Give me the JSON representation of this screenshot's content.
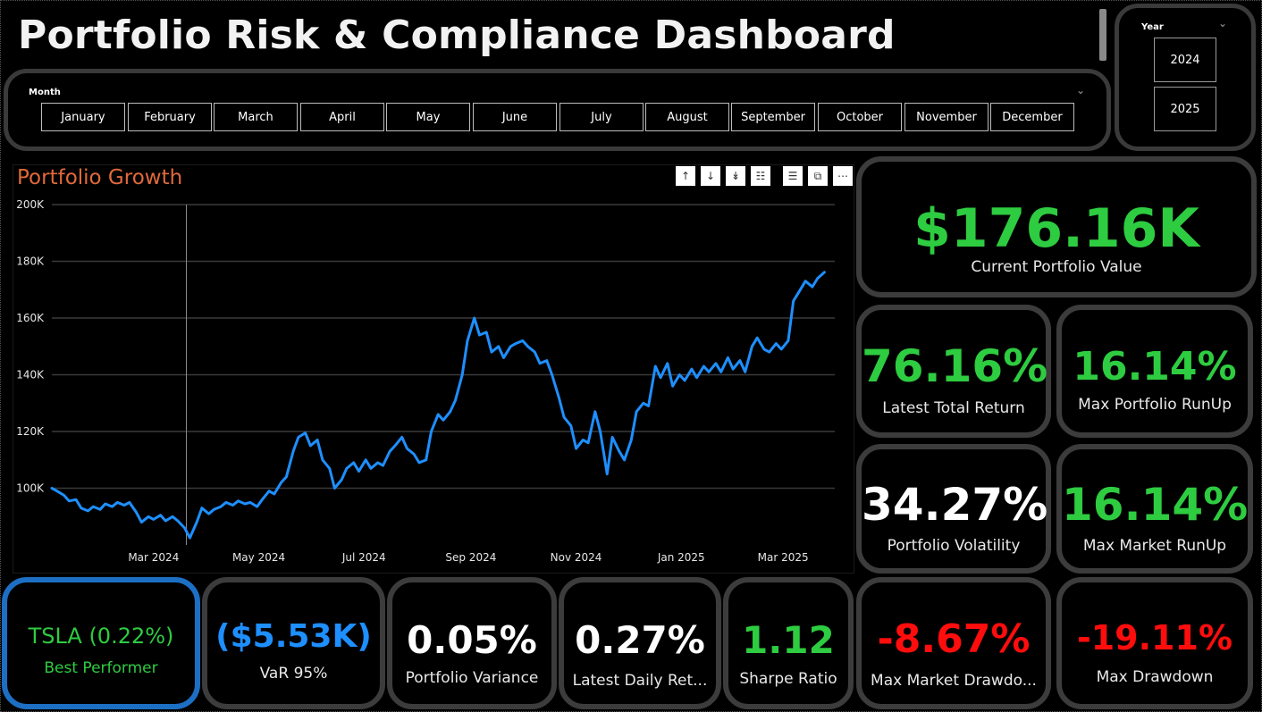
{
  "title": "Portfolio Risk & Compliance Dashboard",
  "month_slicer": {
    "label": "Month",
    "months": [
      "January",
      "February",
      "March",
      "April",
      "May",
      "June",
      "July",
      "August",
      "September",
      "October",
      "November",
      "December"
    ]
  },
  "year_slicer": {
    "label": "Year",
    "years": [
      "2024",
      "2025"
    ]
  },
  "chart_toolbar_icons": [
    "arrow-up-icon",
    "arrow-down-icon",
    "double-arrow-down-icon",
    "hierarchy-icon",
    "filter-icon",
    "focus-mode-icon",
    "more-options-icon"
  ],
  "colors": {
    "positive": "#2ecc40",
    "negative": "#ff0d0d",
    "blue": "#1e8fff",
    "chart_title": "#e0693a",
    "card_border": "#3c3c3c",
    "best_border": "#1d6fc4"
  },
  "kpis": {
    "current_value": {
      "value": "$176.16K",
      "label": "Current Portfolio Value"
    },
    "total_return": {
      "value": "76.16%",
      "label": "Latest Total Return"
    },
    "max_runup": {
      "value": "16.14%",
      "label": "Max Portfolio RunUp"
    },
    "volatility": {
      "value": "34.27%",
      "label": "Portfolio Volatility"
    },
    "market_runup": {
      "value": "16.14%",
      "label": "Max Market RunUp"
    },
    "best_performer": {
      "value": "TSLA (0.22%)",
      "label": "Best Performer"
    },
    "var95": {
      "value": "($5.53K)",
      "label": "VaR 95%"
    },
    "variance": {
      "value": "0.05%",
      "label": "Portfolio Variance"
    },
    "daily_return": {
      "value": "0.27%",
      "label": "Latest Daily Ret..."
    },
    "sharpe": {
      "value": "1.12",
      "label": "Sharpe Ratio"
    },
    "market_drawdown": {
      "value": "-8.67%",
      "label": "Max Market Drawdo..."
    },
    "max_drawdown": {
      "value": "-19.11%",
      "label": "Max Drawdown"
    }
  },
  "chart_data": {
    "type": "line",
    "title": "Portfolio Growth",
    "xlabel": "",
    "ylabel": "",
    "ylim": [
      80000,
      200000
    ],
    "y_ticks": [
      100000,
      120000,
      140000,
      160000,
      180000,
      200000
    ],
    "y_tick_labels": [
      "100K",
      "120K",
      "140K",
      "160K",
      "180K",
      "200K"
    ],
    "x_tick_labels": [
      "Mar 2024",
      "May 2024",
      "Jul 2024",
      "Sep 2024",
      "Nov 2024",
      "Jan 2025",
      "Mar 2025"
    ],
    "x_tick_dates": [
      "2024-03-01",
      "2024-05-01",
      "2024-07-01",
      "2024-09-01",
      "2024-11-01",
      "2025-01-01",
      "2025-03-01"
    ],
    "xlim": [
      "2024-01-02",
      "2025-03-31"
    ],
    "marker_date": "2024-03-20",
    "grid": true,
    "series": [
      {
        "color": "#1e8fff",
        "points": [
          [
            "2024-01-02",
            100000
          ],
          [
            "2024-01-05",
            99000
          ],
          [
            "2024-01-09",
            97500
          ],
          [
            "2024-01-12",
            95500
          ],
          [
            "2024-01-16",
            96000
          ],
          [
            "2024-01-19",
            93000
          ],
          [
            "2024-01-23",
            92000
          ],
          [
            "2024-01-26",
            93500
          ],
          [
            "2024-01-30",
            92500
          ],
          [
            "2024-02-02",
            94500
          ],
          [
            "2024-02-06",
            93500
          ],
          [
            "2024-02-09",
            95000
          ],
          [
            "2024-02-13",
            94000
          ],
          [
            "2024-02-16",
            95000
          ],
          [
            "2024-02-20",
            91500
          ],
          [
            "2024-02-23",
            88000
          ],
          [
            "2024-02-27",
            90000
          ],
          [
            "2024-03-01",
            89000
          ],
          [
            "2024-03-05",
            90500
          ],
          [
            "2024-03-08",
            88500
          ],
          [
            "2024-03-12",
            90000
          ],
          [
            "2024-03-15",
            88500
          ],
          [
            "2024-03-19",
            86000
          ],
          [
            "2024-03-22",
            82500
          ],
          [
            "2024-03-26",
            88000
          ],
          [
            "2024-03-29",
            93000
          ],
          [
            "2024-04-02",
            91000
          ],
          [
            "2024-04-05",
            92500
          ],
          [
            "2024-04-09",
            93500
          ],
          [
            "2024-04-12",
            95000
          ],
          [
            "2024-04-16",
            94000
          ],
          [
            "2024-04-19",
            95500
          ],
          [
            "2024-04-23",
            94500
          ],
          [
            "2024-04-26",
            95000
          ],
          [
            "2024-04-30",
            93500
          ],
          [
            "2024-05-03",
            96000
          ],
          [
            "2024-05-07",
            99000
          ],
          [
            "2024-05-10",
            98000
          ],
          [
            "2024-05-14",
            102000
          ],
          [
            "2024-05-17",
            104000
          ],
          [
            "2024-05-21",
            113000
          ],
          [
            "2024-05-24",
            118000
          ],
          [
            "2024-05-28",
            119500
          ],
          [
            "2024-05-31",
            115000
          ],
          [
            "2024-06-04",
            117000
          ],
          [
            "2024-06-07",
            110000
          ],
          [
            "2024-06-11",
            107000
          ],
          [
            "2024-06-14",
            100000
          ],
          [
            "2024-06-18",
            103000
          ],
          [
            "2024-06-21",
            107000
          ],
          [
            "2024-06-25",
            109000
          ],
          [
            "2024-06-28",
            106000
          ],
          [
            "2024-07-02",
            110000
          ],
          [
            "2024-07-05",
            107000
          ],
          [
            "2024-07-09",
            109000
          ],
          [
            "2024-07-12",
            108000
          ],
          [
            "2024-07-16",
            113000
          ],
          [
            "2024-07-19",
            115000
          ],
          [
            "2024-07-23",
            118000
          ],
          [
            "2024-07-26",
            114000
          ],
          [
            "2024-07-30",
            112000
          ],
          [
            "2024-08-02",
            109000
          ],
          [
            "2024-08-06",
            110000
          ],
          [
            "2024-08-09",
            120000
          ],
          [
            "2024-08-13",
            126000
          ],
          [
            "2024-08-16",
            124000
          ],
          [
            "2024-08-20",
            127000
          ],
          [
            "2024-08-23",
            131000
          ],
          [
            "2024-08-27",
            140000
          ],
          [
            "2024-08-30",
            152000
          ],
          [
            "2024-09-03",
            160000
          ],
          [
            "2024-09-06",
            154000
          ],
          [
            "2024-09-10",
            155000
          ],
          [
            "2024-09-13",
            148000
          ],
          [
            "2024-09-17",
            150000
          ],
          [
            "2024-09-20",
            146000
          ],
          [
            "2024-09-24",
            150000
          ],
          [
            "2024-09-27",
            151000
          ],
          [
            "2024-10-01",
            152000
          ],
          [
            "2024-10-04",
            150000
          ],
          [
            "2024-10-08",
            148000
          ],
          [
            "2024-10-11",
            144000
          ],
          [
            "2024-10-15",
            145000
          ],
          [
            "2024-10-18",
            140000
          ],
          [
            "2024-10-22",
            132000
          ],
          [
            "2024-10-25",
            125000
          ],
          [
            "2024-10-29",
            122000
          ],
          [
            "2024-11-01",
            114000
          ],
          [
            "2024-11-05",
            117000
          ],
          [
            "2024-11-08",
            116000
          ],
          [
            "2024-11-12",
            127000
          ],
          [
            "2024-11-15",
            120000
          ],
          [
            "2024-11-19",
            105000
          ],
          [
            "2024-11-22",
            118000
          ],
          [
            "2024-11-26",
            113000
          ],
          [
            "2024-11-29",
            110000
          ],
          [
            "2024-12-03",
            117000
          ],
          [
            "2024-12-06",
            127000
          ],
          [
            "2024-12-10",
            130000
          ],
          [
            "2024-12-13",
            129000
          ],
          [
            "2024-12-17",
            143000
          ],
          [
            "2024-12-20",
            139000
          ],
          [
            "2024-12-24",
            144000
          ],
          [
            "2024-12-27",
            136000
          ],
          [
            "2024-12-31",
            140000
          ],
          [
            "2025-01-03",
            138000
          ],
          [
            "2025-01-07",
            142000
          ],
          [
            "2025-01-10",
            139000
          ],
          [
            "2025-01-14",
            143000
          ],
          [
            "2025-01-17",
            141000
          ],
          [
            "2025-01-21",
            144000
          ],
          [
            "2025-01-24",
            141000
          ],
          [
            "2025-01-28",
            146000
          ],
          [
            "2025-01-31",
            142000
          ],
          [
            "2025-02-04",
            145000
          ],
          [
            "2025-02-07",
            141000
          ],
          [
            "2025-02-11",
            150000
          ],
          [
            "2025-02-14",
            153000
          ],
          [
            "2025-02-18",
            149000
          ],
          [
            "2025-02-21",
            148000
          ],
          [
            "2025-02-25",
            151000
          ],
          [
            "2025-02-28",
            149000
          ],
          [
            "2025-03-04",
            152000
          ],
          [
            "2025-03-07",
            166000
          ],
          [
            "2025-03-11",
            170000
          ],
          [
            "2025-03-14",
            173000
          ],
          [
            "2025-03-18",
            171000
          ],
          [
            "2025-03-21",
            174000
          ],
          [
            "2025-03-25",
            176160
          ]
        ]
      }
    ]
  }
}
